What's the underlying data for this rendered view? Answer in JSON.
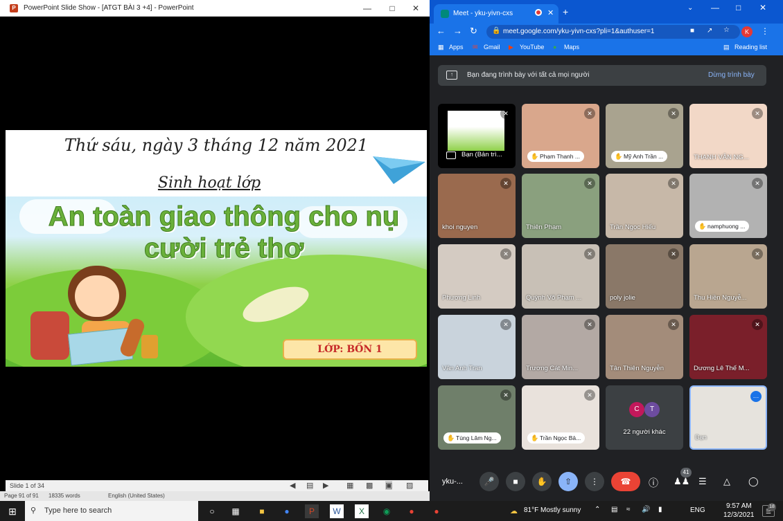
{
  "ppt": {
    "window_title": "PowerPoint Slide Show - [ATGT BÀI 3 +4] - PowerPoint",
    "slide": {
      "date_line": "Thứ sáu, ngày 3 tháng 12 năm 2021",
      "subject": "Sinh hoạt lớp",
      "title": "An toàn giao thông cho nụ cười trẻ thơ",
      "class_label": "LỚP: BỐN 1"
    },
    "status": {
      "slide_counter": "Slide 1 of 34"
    },
    "word_status": {
      "page": "Page 91 of 91",
      "words": "18335 words",
      "language": "English (United States)"
    }
  },
  "chrome": {
    "tab_title": "Meet - yku-yivn-cxs",
    "url": "meet.google.com/yku-yivn-cxs?pli=1&authuser=1",
    "profile_initial": "K",
    "bookmarks": [
      "Apps",
      "Gmail",
      "YouTube",
      "Maps"
    ],
    "reading_list": "Reading list"
  },
  "meet": {
    "presenting_text": "Bạn đang trình bày với tất cả mọi người",
    "stop_presenting": "Dừng trình bày",
    "tiles": [
      {
        "name": "Bạn (Bản trì...",
        "style": "pres"
      },
      {
        "name": "Phạm Thanh ...",
        "style": "pill"
      },
      {
        "name": "Mỹ Anh Trần ...",
        "style": "pill"
      },
      {
        "name": "THANH VÂN NG...",
        "style": "plain"
      },
      {
        "name": "khoi nguyen",
        "style": "plain"
      },
      {
        "name": "Thiên Phạm",
        "style": "plain"
      },
      {
        "name": "Trần Ngọc Hiếu",
        "style": "plain"
      },
      {
        "name": "namphuong ...",
        "style": "pill"
      },
      {
        "name": "Phương Linh",
        "style": "plain"
      },
      {
        "name": "Quỳnh Võ Phạm ...",
        "style": "plain"
      },
      {
        "name": "poly jolie",
        "style": "plain"
      },
      {
        "name": "Thu Hiền Nguyễ...",
        "style": "plain"
      },
      {
        "name": "Vân Anh Tran",
        "style": "plain"
      },
      {
        "name": "Trương Cát Min...",
        "style": "plain"
      },
      {
        "name": "Tân Thiên Nguyễn",
        "style": "plain"
      },
      {
        "name": "Dương Lê Thế M...",
        "style": "plain"
      },
      {
        "name": "Tùng Lâm Ng...",
        "style": "pill"
      },
      {
        "name": "Trần Ngọc Bả...",
        "style": "pill"
      },
      {
        "name": "22 người khác",
        "style": "others"
      },
      {
        "name": "Bạn",
        "style": "self"
      }
    ],
    "others_initials": [
      "C",
      "T"
    ],
    "meeting_code": "yku-...",
    "participants_badge": "41"
  },
  "taskbar": {
    "search_placeholder": "Type here to search",
    "weather": "81°F  Mostly sunny",
    "lang": "ENG",
    "time": "9:57 AM",
    "date": "12/3/2021",
    "notif_count": "18"
  }
}
